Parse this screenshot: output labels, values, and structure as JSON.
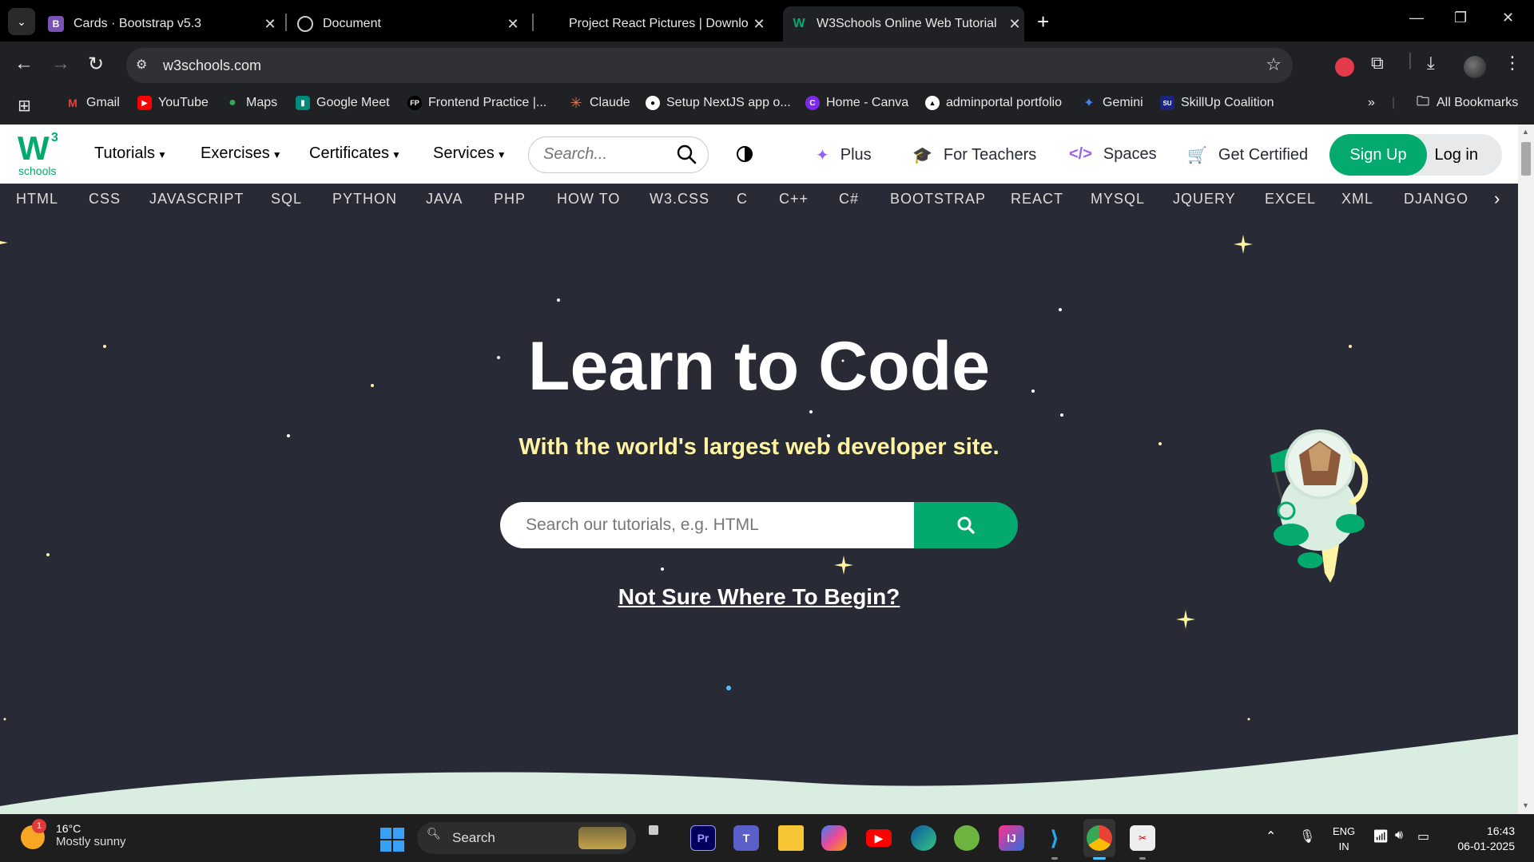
{
  "browser": {
    "tabs": [
      {
        "title": "Cards · Bootstrap v5.3",
        "favicon": "B",
        "favicon_color": "#7952b3"
      },
      {
        "title": "Document",
        "favicon": "globe"
      },
      {
        "title": "Project React Pictures | Downlo",
        "favicon": ""
      },
      {
        "title": "W3Schools Online Web Tutorial",
        "favicon": "W",
        "favicon_color": "#04aa6d",
        "active": true
      }
    ],
    "url": "w3schools.com",
    "bookmarks": [
      {
        "label": "Gmail",
        "icon": "gmail-icon"
      },
      {
        "label": "YouTube",
        "icon": "youtube-icon"
      },
      {
        "label": "Maps",
        "icon": "maps-icon"
      },
      {
        "label": "Google Meet",
        "icon": "meet-icon"
      },
      {
        "label": "Frontend Practice |...",
        "icon": "FP"
      },
      {
        "label": "Claude",
        "icon": "claude-icon"
      },
      {
        "label": "Setup NextJS app o...",
        "icon": "github-icon"
      },
      {
        "label": "Home - Canva",
        "icon": "canva-icon"
      },
      {
        "label": "adminportal portfolio",
        "icon": "triangle-icon"
      },
      {
        "label": "Gemini",
        "icon": "gemini-icon"
      },
      {
        "label": "SkillUp Coalition",
        "icon": "SU"
      }
    ],
    "all_bookmarks": "All Bookmarks"
  },
  "header": {
    "logo_mark": "W",
    "logo_sup": "3",
    "logo_text": "schools",
    "menus": [
      "Tutorials",
      "Exercises",
      "Certificates",
      "Services"
    ],
    "search_placeholder": "Search...",
    "links": {
      "plus": "Plus",
      "teachers": "For Teachers",
      "spaces": "Spaces",
      "certified": "Get Certified"
    },
    "signup": "Sign Up",
    "login": "Log in"
  },
  "topics": [
    "HTML",
    "CSS",
    "JAVASCRIPT",
    "SQL",
    "PYTHON",
    "JAVA",
    "PHP",
    "HOW TO",
    "W3.CSS",
    "C",
    "C++",
    "C#",
    "BOOTSTRAP",
    "REACT",
    "MYSQL",
    "JQUERY",
    "EXCEL",
    "XML",
    "DJANGO"
  ],
  "hero": {
    "title": "Learn to Code",
    "subtitle": "With the world's largest web developer site.",
    "search_placeholder": "Search our tutorials, e.g. HTML",
    "link": "Not Sure Where To Begin?"
  },
  "taskbar": {
    "weather_temp": "16°C",
    "weather_desc": "Mostly sunny",
    "weather_badge": "1",
    "search_label": "Search",
    "lang_top": "ENG",
    "lang_bottom": "IN",
    "time": "16:43",
    "date": "06-01-2025"
  },
  "colors": {
    "w3_green": "#04aa6d",
    "hero_bg": "#282a35",
    "subtitle": "#fff4a3",
    "wave": "#d9eee1"
  }
}
